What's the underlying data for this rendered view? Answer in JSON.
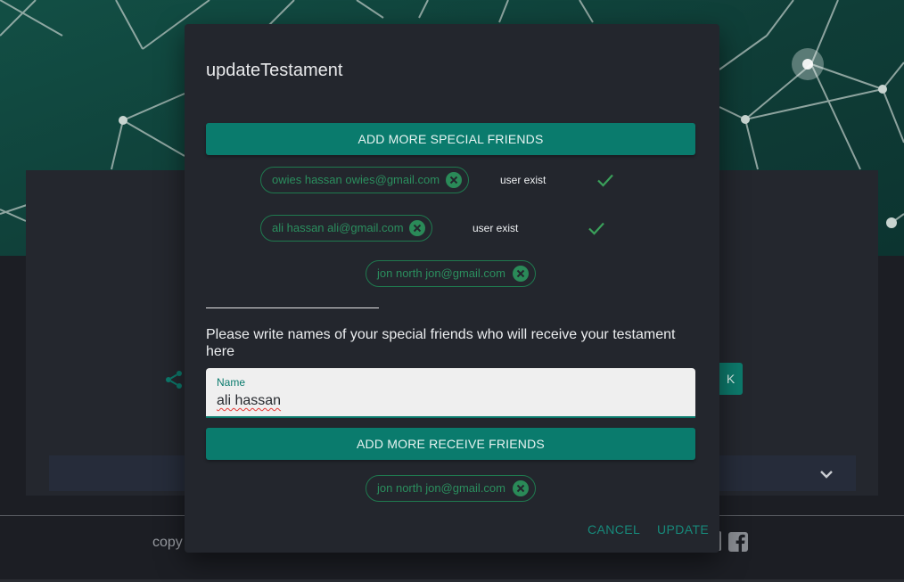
{
  "dialog": {
    "title": "updateTestament",
    "add_special_label": "ADD MORE SPECIAL FRIENDS",
    "special_friends": [
      {
        "chip": "owies hassan owies@gmail.com",
        "status": "user exist",
        "verified": true
      },
      {
        "chip": "ali hassan ali@gmail.com",
        "status": "user exist",
        "verified": true
      },
      {
        "chip": "jon north jon@gmail.com",
        "status": "",
        "verified": false
      }
    ],
    "instructions": "Please write names of your special friends who will receive your testament here",
    "name_field": {
      "label": "Name",
      "value": "ali hassan"
    },
    "add_receive_label": "ADD MORE RECEIVE FRIENDS",
    "receive_friends": [
      {
        "chip": "jon north jon@gmail.com"
      }
    ],
    "cancel_label": "CANCEL",
    "update_label": "UPDATE"
  },
  "background": {
    "button_fragment": "K",
    "footer_text_fragment": "copy"
  },
  "colors": {
    "accent": "#0a7b6d",
    "chip_green": "#2b8e5e",
    "dialog_bg": "#23262d",
    "hero": "#0f4a41"
  }
}
